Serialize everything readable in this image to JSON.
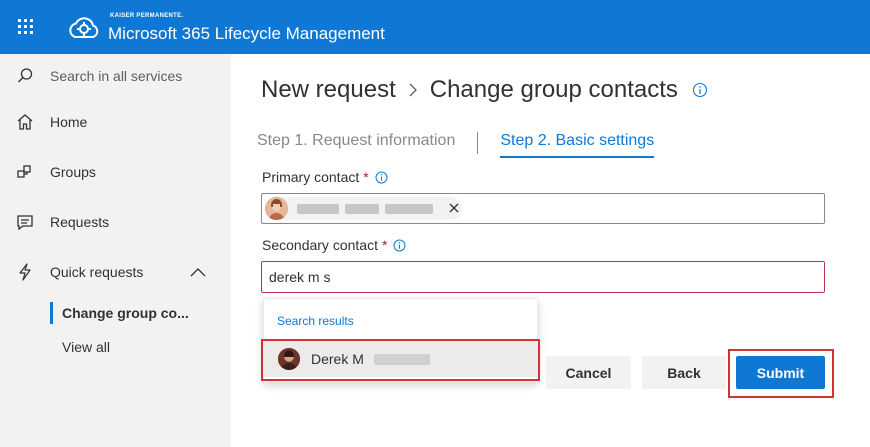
{
  "header": {
    "brand_small": "KAISER PERMANENTE.",
    "app_title": "Microsoft 365 Lifecycle Management"
  },
  "sidebar": {
    "search_label": "Search in all services",
    "items": [
      {
        "label": "Home",
        "icon": "home-icon"
      },
      {
        "label": "Groups",
        "icon": "groups-icon"
      },
      {
        "label": "Requests",
        "icon": "requests-icon"
      },
      {
        "label": "Quick requests",
        "icon": "lightning-icon"
      }
    ],
    "sub_items": [
      {
        "label": "Change group co...",
        "active": true
      },
      {
        "label": "View all",
        "active": false
      }
    ]
  },
  "main": {
    "breadcrumb": [
      "New request",
      "Change group contacts"
    ],
    "steps": [
      {
        "label": "Step 1. Request information",
        "active": false
      },
      {
        "label": "Step 2. Basic settings",
        "active": true
      }
    ],
    "primary_contact": {
      "label": "Primary contact",
      "required_mark": "*"
    },
    "secondary_contact": {
      "label": "Secondary contact",
      "required_mark": "*",
      "value": "derek m s"
    },
    "suggestions": {
      "header": "Search results",
      "items": [
        {
          "name": "Derek M"
        }
      ]
    },
    "buttons": {
      "cancel": "Cancel",
      "back": "Back",
      "submit": "Submit"
    }
  },
  "colors": {
    "brand": "#0e78d4",
    "sidebar_bg": "#f3f2f1",
    "highlight": "#d13438",
    "error_border": "#c4314b"
  }
}
